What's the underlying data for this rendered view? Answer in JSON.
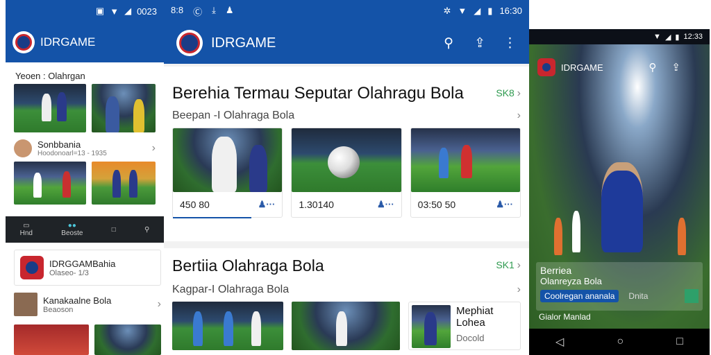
{
  "left": {
    "status_time": "0023",
    "app_title": "IDRGAME",
    "section1_title": "Yeoen : Olahrgan",
    "item1_title": "Sonbbania",
    "item1_sub": "Hoodonoarl=13 - 1935",
    "nav": [
      {
        "label": "Hnd"
      },
      {
        "label": "Beoste"
      },
      {
        "label": ""
      },
      {
        "label": ""
      }
    ],
    "card2_title": "IDRGGAMBahia",
    "card2_sub": "Olaseo- 1/3",
    "item3_title": "Kanakaalne Bola",
    "item3_sub": "Beaoson"
  },
  "center": {
    "status_left": "8:8",
    "status_time": "16:30",
    "app_title": "IDRGAME",
    "section1": {
      "title": "Berehia Termau Seputar Olahragu Bola",
      "link": "SK8",
      "subtitle": "Beepan -I Olahraga Bola",
      "cards": [
        {
          "value": "450 80"
        },
        {
          "value": "1.30140"
        },
        {
          "value": "03:50 50"
        }
      ]
    },
    "section2": {
      "title": "Bertiia Olahraga Bola",
      "link": "SK1",
      "subtitle": "Kagpar-I Olahraga Bola",
      "side_title_1": "Mephiat",
      "side_title_2": "Lohea",
      "side_sub": "Docold"
    }
  },
  "right": {
    "status_time": "12:33",
    "app_title": "IDRGAME",
    "headline_1": "Berriea",
    "headline_2": "Olanreyza Bola",
    "chip": "Coolregan ananala",
    "chip_side": "Dnita",
    "footer": "Gialor Manlad"
  },
  "colors": {
    "primary": "#1453a8",
    "primary_dark": "#0e3f86",
    "accent_green": "#2e9a4f",
    "nav_dark": "#1f2327"
  },
  "icons": [
    "search-icon",
    "share-icon",
    "more-icon",
    "chevron-right-icon",
    "user-icon",
    "back-icon",
    "home-icon",
    "recents-icon",
    "wifi-icon",
    "battery-icon"
  ]
}
